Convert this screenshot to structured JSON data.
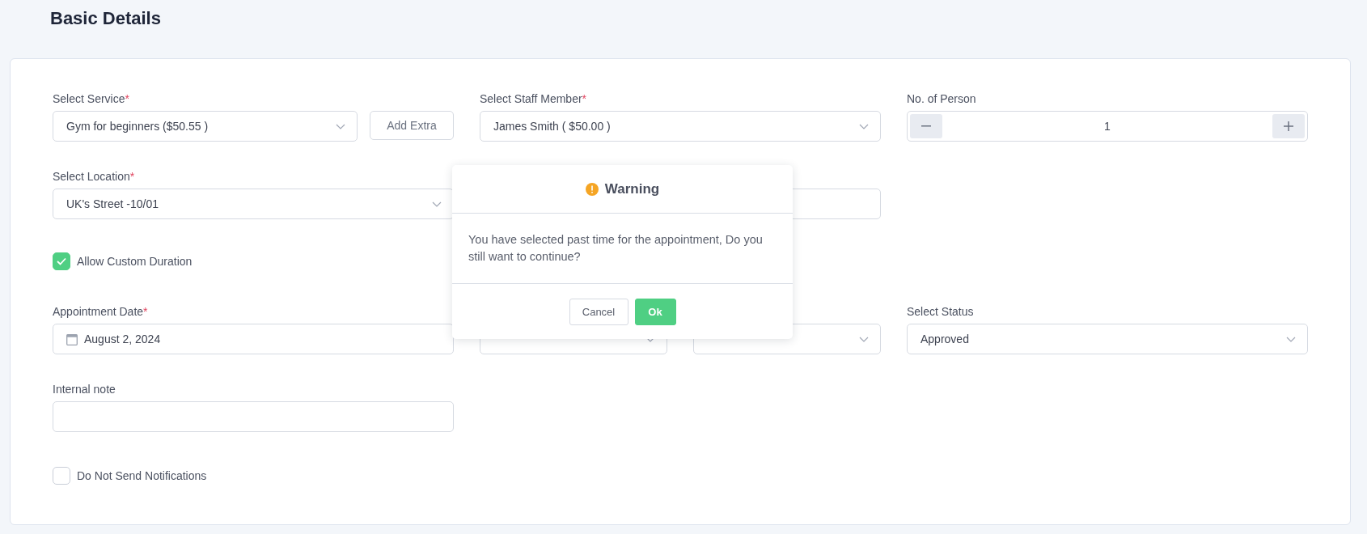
{
  "page": {
    "title": "Basic Details"
  },
  "form": {
    "service": {
      "label": "Select Service",
      "required_mark": "*",
      "value": "Gym for beginners ($50.55 )",
      "add_extra": "Add Extra"
    },
    "staff": {
      "label": "Select Staff Member",
      "required_mark": "*",
      "value": "James Smith ( $50.00 )"
    },
    "persons": {
      "label": "No. of Person",
      "value": "1"
    },
    "location": {
      "label": "Select Location",
      "required_mark": "*",
      "value": "UK's Street -10/01"
    },
    "custom_duration": {
      "label": "Allow Custom Duration",
      "checked": true
    },
    "appointment_date": {
      "label": "Appointment Date",
      "required_mark": "*",
      "value": "August 2, 2024"
    },
    "status": {
      "label": "Select Status",
      "value": "Approved"
    },
    "internal_note": {
      "label": "Internal note"
    },
    "no_notifications": {
      "label": "Do Not Send Notifications",
      "checked": false
    }
  },
  "dialog": {
    "title": "Warning",
    "message": "You have selected past time for the appointment, Do you still want to continue?",
    "buttons": [
      {
        "label": "Cancel",
        "kind": "secondary"
      },
      {
        "label": "Ok",
        "kind": "primary"
      }
    ]
  }
}
